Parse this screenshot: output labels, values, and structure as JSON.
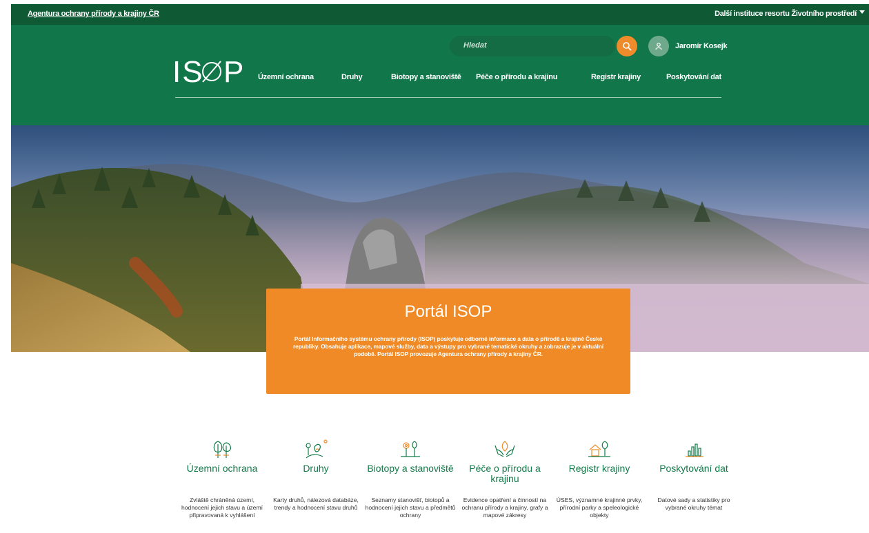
{
  "topbar": {
    "agency_link": "Agentura ochrany přírody a krajiny ČR",
    "ministry_link": "Další instituce resortu Životního prostředí"
  },
  "header": {
    "logo_text": "IS P",
    "search_placeholder": "Hledat",
    "user_name": "Jaromír Kosejk",
    "nav": [
      {
        "label": "Územní ochrana"
      },
      {
        "label": "Druhy"
      },
      {
        "label": "Biotopy a stanoviště"
      },
      {
        "label": "Péče o přírodu a krajinu"
      },
      {
        "label": "Registr krajiny"
      },
      {
        "label": "Poskytování dat"
      }
    ]
  },
  "hero": {
    "title": "Portál ISOP",
    "text": "Portál Informačního systému ochrany přírody (ISOP) poskytuje odborné informace a data o přírodě a krajině České republiky. Obsahuje aplikace, mapové služby, data a výstupy pro vybrané tematické okruhy a zobrazuje je v aktuální podobě. Portál ISOP provozuje Agentura ochrany přírody a krajiny ČR."
  },
  "categories": [
    {
      "title": "Územní ochrana",
      "description": "Zvláště chráněná území, hodnocení jejich stavu a území připravovaná k vyhlášení",
      "icon": "trees-icon"
    },
    {
      "title": "Druhy",
      "description": "Karty druhů, nálezová databáze, trendy a hodnocení stavu druhů",
      "icon": "species-icon"
    },
    {
      "title": "Biotopy a stanoviště",
      "description": "Seznamy stanovišť, biotopů a hodnocení jejich stavu a předmětů ochrany",
      "icon": "habitat-icon"
    },
    {
      "title": "Péče o přírodu a krajinu",
      "description": "Evidence opatření a činností na ochranu přírody a krajiny, grafy a mapové zákresy",
      "icon": "care-hands-icon"
    },
    {
      "title": "Registr krajiny",
      "description": "ÚSES, významné krajinné prvky, přírodní parky a speleologické objekty",
      "icon": "landscape-register-icon"
    },
    {
      "title": "Poskytování dat",
      "description": "Datové sady a statistiky pro vybrané okruhy témat",
      "icon": "data-chart-icon"
    }
  ],
  "colors": {
    "topbar": "#0f5a35",
    "header": "#11774a",
    "accent": "#ef8a26",
    "category_title": "#127a48"
  }
}
